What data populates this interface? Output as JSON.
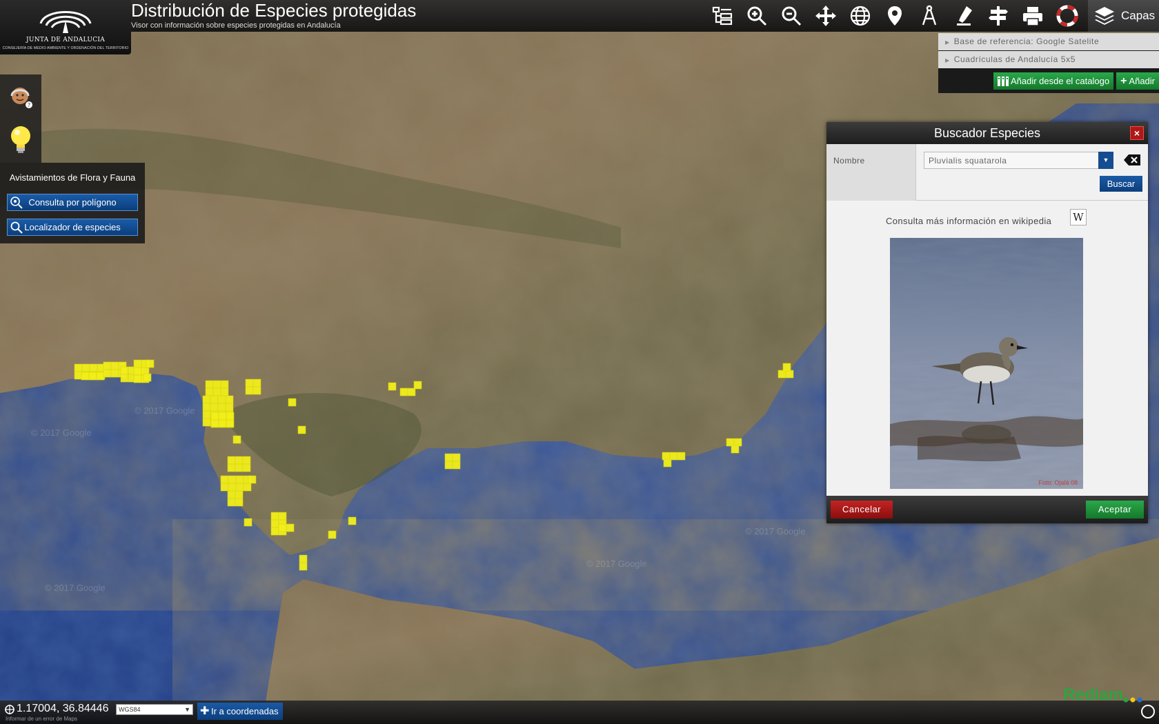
{
  "header": {
    "logo_title": "JUNTA DE ANDALUCIA",
    "logo_subtitle": "CONSEJERÍA DE MEDIO AMBIENTE Y ORDENACIÓN DEL TERRITORIO",
    "title": "Distribución de Especies protegidas",
    "subtitle": "Visor con información sobre especies protegidas en Andalucía",
    "capas_label": "Capas"
  },
  "toolbar": {
    "tools": [
      "layers-tree-icon",
      "zoom-in-icon",
      "zoom-out-icon",
      "pan-icon",
      "globe-icon",
      "location-pin-icon",
      "measure-icon",
      "draw-icon",
      "signpost-icon",
      "print-icon",
      "help-lifebuoy-icon"
    ]
  },
  "layers": {
    "items": [
      "Base de referencia: Google Satelite",
      "Cuadrículas de Andalucía 5x5"
    ],
    "add_catalog_label": "Añadir desde el catalogo",
    "add_label": "Añadir"
  },
  "left_panel": {
    "title": "Avistamientos de Flora y Fauna",
    "buttons": [
      "Consulta por polígono",
      "Localizador de especies"
    ]
  },
  "dialog": {
    "title": "Buscador Especies",
    "close_label": "×",
    "name_label": "Nombre",
    "species_value": "Pluvialis squatarola",
    "search_label": "Buscar",
    "wiki_text": "Consulta más información en wikipedia",
    "wiki_label": "W",
    "photo_credit": "Foto: Ojalá 08",
    "cancel_label": "Cancelar",
    "accept_label": "Aceptar"
  },
  "map": {
    "watermark": "© 2017 Google"
  },
  "statusbar": {
    "coordinates": "1.17004, 36.84446",
    "crs": "WGS84",
    "goto_label": "Ir a coordenadas",
    "maps_error": "Informar de un error de Maps",
    "brand": "Rediam"
  },
  "colors": {
    "grid_cells": "#f2ef1c",
    "accent_green": "#14792c",
    "accent_blue": "#0c3f7e",
    "danger_red": "#8a0e0e",
    "sea": "#2d4a96",
    "land": "#8a7658"
  }
}
